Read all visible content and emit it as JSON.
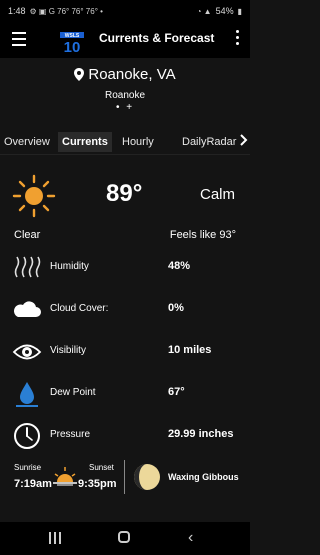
{
  "status": {
    "time": "1:48",
    "icons_left": "⚙ ▣ G 76° 76° 76° •",
    "battery": "54%"
  },
  "appbar": {
    "title": "Currents & Forecast",
    "logo_text": "WSLS 10"
  },
  "location": {
    "name": "Roanoke, VA",
    "sub": "Roanoke",
    "pager": "• +"
  },
  "tabs": [
    {
      "label": "Overview"
    },
    {
      "label": "Currents"
    },
    {
      "label": "Hourly"
    },
    {
      "label": "DailyRadar"
    }
  ],
  "current": {
    "temp": "89°",
    "wind": "Calm",
    "condition": "Clear",
    "feels_like": "Feels like 93°"
  },
  "details": [
    {
      "label": "Humidity",
      "value": "48%",
      "icon": "humidity-icon"
    },
    {
      "label": "Cloud Cover:",
      "value": "0%",
      "icon": "cloud-icon"
    },
    {
      "label": "Visibility",
      "value": "10 miles",
      "icon": "eye-icon"
    },
    {
      "label": "Dew Point",
      "value": "67°",
      "icon": "dew-point-icon"
    },
    {
      "label": "Pressure",
      "value": "29.99 inches",
      "icon": "pressure-gauge-icon"
    }
  ],
  "astro": {
    "sunrise_label": "Sunrise",
    "sunset_label": "Sunset",
    "sunrise": "7:19am",
    "sunset": "9:35pm",
    "moon_phase": "Waxing Gibbous"
  },
  "colors": {
    "background": "#141414",
    "bar": "#000000",
    "sun": "#f0a030",
    "water": "#2a7fd4"
  }
}
